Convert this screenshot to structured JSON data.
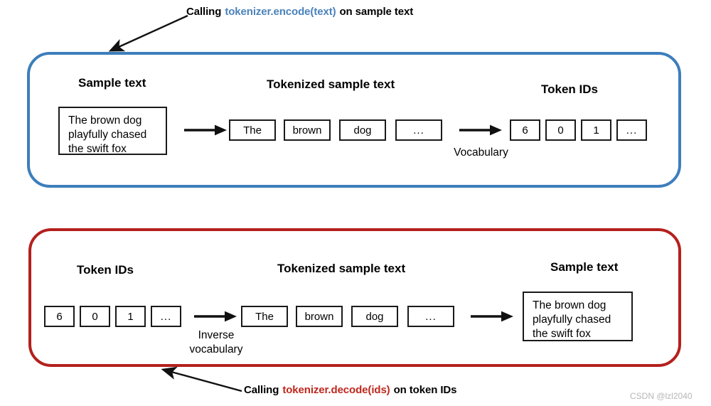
{
  "captions": {
    "encode": {
      "prefix": "Calling",
      "code": "tokenizer.encode(text)",
      "suffix": "on sample text",
      "code_color": "#4a82bc"
    },
    "decode": {
      "prefix": "Calling",
      "code": "tokenizer.decode(ids)",
      "suffix": "on token IDs",
      "code_color": "#c0271d"
    }
  },
  "encode_panel": {
    "border_color": "#3d7ebc",
    "headings": {
      "sample_text": "Sample text",
      "tokenized": "Tokenized sample text",
      "token_ids": "Token IDs"
    },
    "sample_text": "The brown dog\nplayfully chased\nthe swift fox",
    "tokens": [
      "The",
      "brown",
      "dog",
      "..."
    ],
    "token_ids": [
      "6",
      "0",
      "1",
      "..."
    ],
    "arrow_label": "Vocabulary"
  },
  "decode_panel": {
    "border_color": "#b4201d",
    "headings": {
      "token_ids": "Token IDs",
      "tokenized": "Tokenized sample text",
      "sample_text": "Sample text"
    },
    "token_ids": [
      "6",
      "0",
      "1",
      "..."
    ],
    "tokens": [
      "The",
      "brown",
      "dog",
      "..."
    ],
    "sample_text": "The brown dog\nplayfully chased\nthe swift fox",
    "arrow_label": "Inverse\nvocabulary"
  },
  "watermark": "CSDN @lzl2040"
}
